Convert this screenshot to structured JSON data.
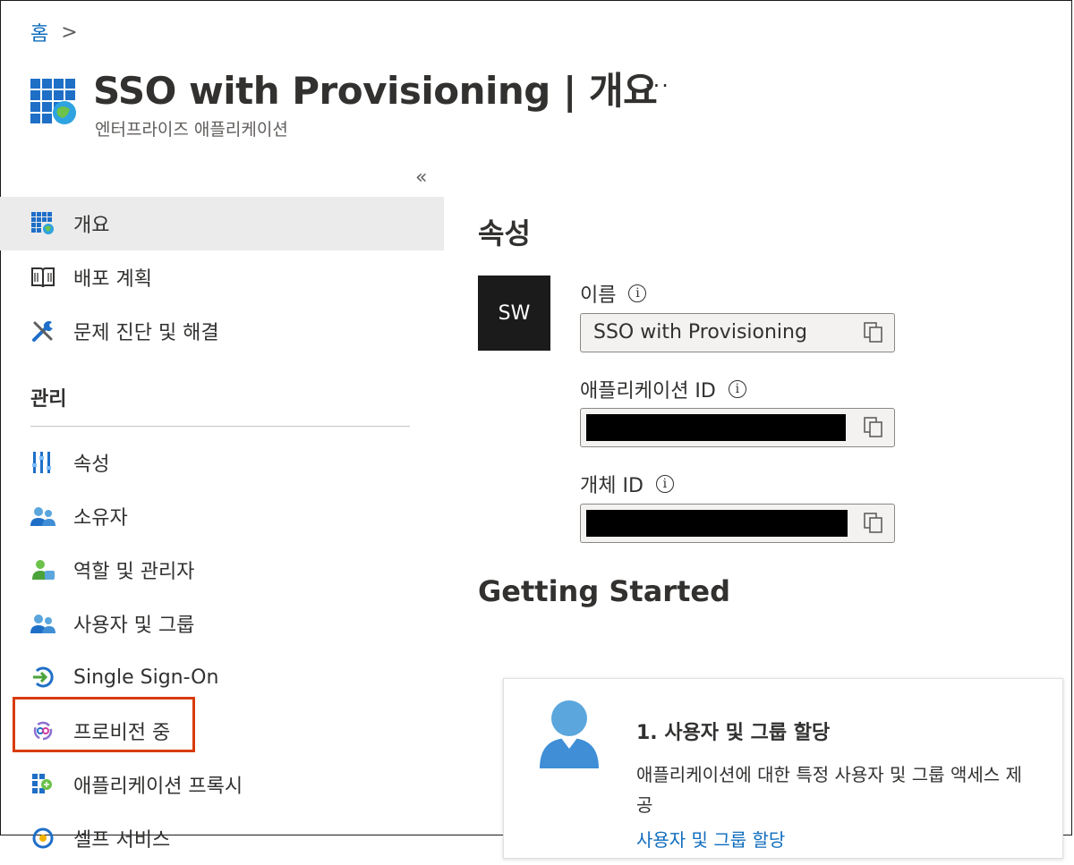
{
  "breadcrumb": {
    "home": "홈",
    "separator": ">"
  },
  "header": {
    "title": "SSO with Provisioning | 개요",
    "more": "···",
    "subtitle": "엔터프라이즈 애플리케이션",
    "collapse": "«"
  },
  "sidebar": {
    "items_top": [
      {
        "label": "개요",
        "icon": "grid-globe-icon",
        "active": true
      },
      {
        "label": "배포 계획",
        "icon": "book-icon"
      },
      {
        "label": "문제 진단 및 해결",
        "icon": "wrench-icon"
      }
    ],
    "section_label": "관리",
    "items_manage": [
      {
        "label": "속성",
        "icon": "properties-icon"
      },
      {
        "label": "소유자",
        "icon": "users-icon"
      },
      {
        "label": "역할 및 관리자",
        "icon": "user-role-icon"
      },
      {
        "label": "사용자 및 그룹",
        "icon": "users-icon"
      },
      {
        "label": "Single Sign-On",
        "icon": "sso-arrow-icon"
      },
      {
        "label": "프로비전 중",
        "icon": "provisioning-icon"
      },
      {
        "label": "애플리케이션 프록시",
        "icon": "app-proxy-icon"
      },
      {
        "label": "셀프 서비스",
        "icon": "self-service-icon"
      }
    ]
  },
  "main": {
    "properties_heading": "속성",
    "avatar_initials": "SW",
    "fields": [
      {
        "label": "이름",
        "value": "SSO with Provisioning"
      },
      {
        "label": "애플리케이션 ID",
        "value": ""
      },
      {
        "label": "개체 ID",
        "value": ""
      }
    ],
    "info_glyph": "i",
    "getting_started_heading": "Getting Started",
    "card": {
      "title": "1. 사용자 및 그룹 할당",
      "description": "애플리케이션에 대한 특정 사용자 및 그룹 액세스 제공",
      "link": "사용자 및 그룹 할당"
    }
  },
  "colors": {
    "link": "#0f6cbd",
    "highlight": "#d83b01",
    "active_bg": "#ebebeb"
  }
}
